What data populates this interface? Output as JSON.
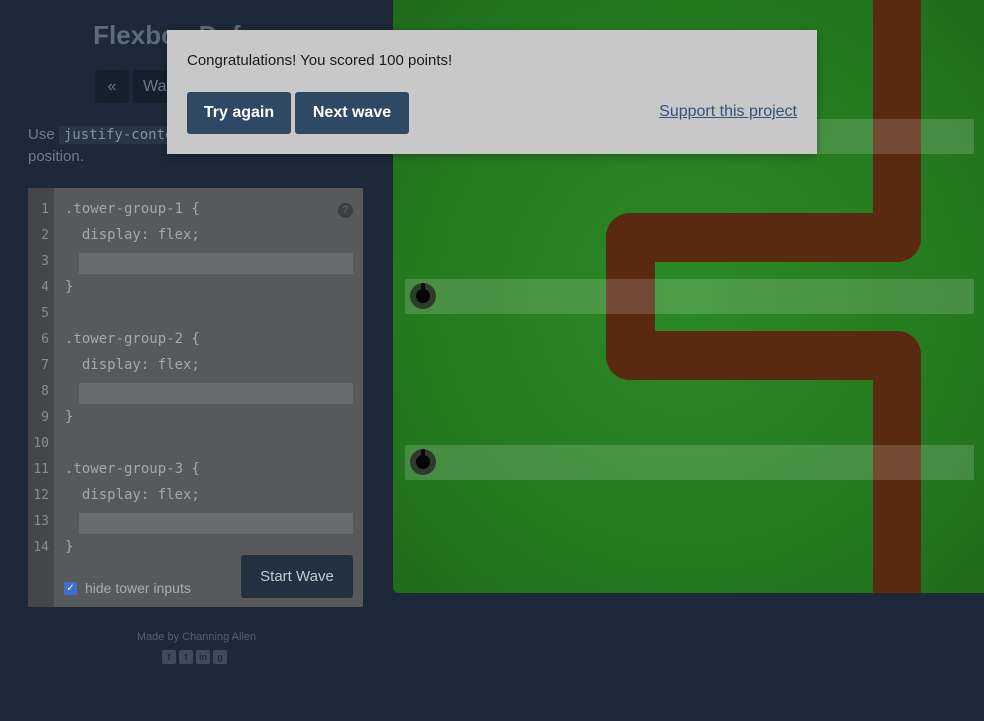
{
  "header": {
    "title": "Flexbox Defense",
    "prev_wave": "«",
    "wave_label": "Wave"
  },
  "instructions": {
    "prefix": "Use",
    "property": "justify-content",
    "suffix": "position."
  },
  "editor": {
    "lines": [
      {
        "no": "1",
        "text": ".tower-group-1 {"
      },
      {
        "no": "2",
        "text": "  display: flex;"
      },
      {
        "no": "3",
        "text": ""
      },
      {
        "no": "4",
        "text": "}"
      },
      {
        "no": "5",
        "text": ""
      },
      {
        "no": "6",
        "text": ".tower-group-2 {"
      },
      {
        "no": "7",
        "text": "  display: flex;"
      },
      {
        "no": "8",
        "text": ""
      },
      {
        "no": "9",
        "text": "}"
      },
      {
        "no": "10",
        "text": ""
      },
      {
        "no": "11",
        "text": ".tower-group-3 {"
      },
      {
        "no": "12",
        "text": "  display: flex;"
      },
      {
        "no": "13",
        "text": ""
      },
      {
        "no": "14",
        "text": "}"
      }
    ],
    "hide_inputs_label": "hide tower inputs",
    "hide_inputs_checked": true,
    "start_button": "Start Wave",
    "help_icon": "?"
  },
  "footer": {
    "credit": "Made by Channing Allen",
    "social_icons": [
      "facebook-icon",
      "twitter-icon",
      "linkedin-icon",
      "github-icon"
    ]
  },
  "modal": {
    "message": "Congratulations! You scored 100 points!",
    "try_again": "Try again",
    "next_wave": "Next wave",
    "support_link": "Support this project"
  },
  "colors": {
    "board_green": "#24781f",
    "path_brown": "#5a2a10",
    "modal_bg": "#c8c8c8",
    "button_blue": "#2f4864"
  }
}
